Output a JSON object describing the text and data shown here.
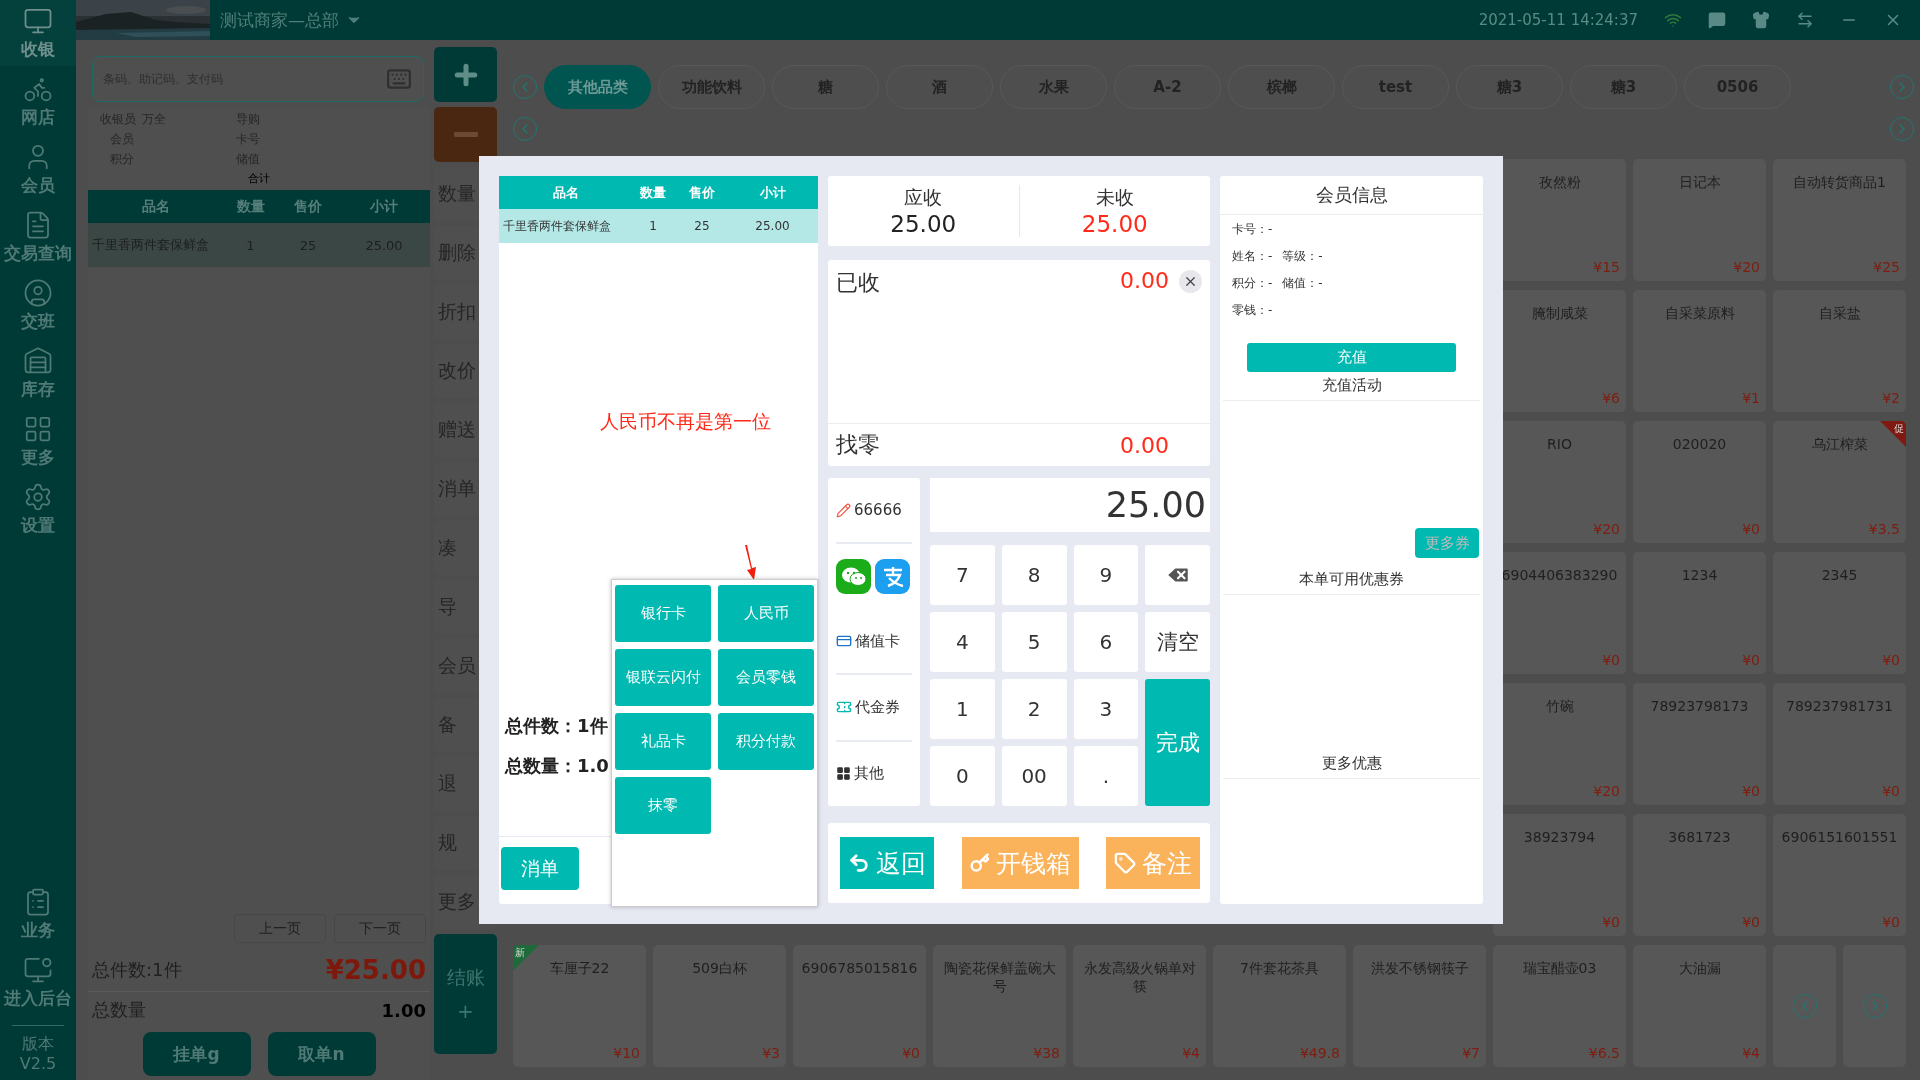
{
  "sidebar": {
    "items": [
      {
        "label": "收银",
        "selected": true
      },
      {
        "label": "网店",
        "selected": false
      },
      {
        "label": "会员",
        "selected": false
      },
      {
        "label": "交易查询",
        "selected": false
      },
      {
        "label": "交班",
        "selected": false
      },
      {
        "label": "库存",
        "selected": false
      },
      {
        "label": "更多",
        "selected": false
      },
      {
        "label": "设置",
        "selected": false
      }
    ],
    "bottom_items": [
      {
        "label": "业务"
      },
      {
        "label": "进入后台"
      }
    ],
    "version_label": "版本",
    "version": "V2.5"
  },
  "top_bar": {
    "store": "测试商家—总部",
    "datetime": "2021-05-11 14:24:37"
  },
  "search": {
    "placeholder": "条码、助记码、支付码"
  },
  "order_info": {
    "cashier_label": "收银员",
    "cashier": "万全",
    "guide_label": "导购",
    "member_label": "会员",
    "card_label": "卡号",
    "points_label": "积分",
    "balance_label": "储值",
    "total_label": "合计"
  },
  "cart": {
    "columns": [
      "品名",
      "数量",
      "售价",
      "小计"
    ],
    "rows": [
      {
        "cells": [
          "千里香两件套保鲜盒",
          "1",
          "25",
          "25.00"
        ],
        "selected": true
      }
    ]
  },
  "pager": {
    "prev": "上一页",
    "next": "下一页"
  },
  "totals": {
    "items": "总件数:1件",
    "amount": "¥25.00",
    "qty_label": "总数量",
    "qty": "1.00"
  },
  "left_buttons": [
    "挂单g",
    "取单n"
  ],
  "action_buttons": [
    "数量",
    "删除",
    "折扣",
    "改价",
    "赠送",
    "消单",
    "凑",
    "导",
    "会员",
    "备",
    "退",
    "规",
    "更多"
  ],
  "checkout": {
    "label": "结账",
    "sub": "+"
  },
  "categories": [
    {
      "label": "其他品类",
      "selected": true
    },
    {
      "label": "功能饮料",
      "selected": false
    },
    {
      "label": "糖",
      "selected": false
    },
    {
      "label": "酒",
      "selected": false
    },
    {
      "label": "水果",
      "selected": false
    },
    {
      "label": "A-2",
      "selected": false
    },
    {
      "label": "槟榔",
      "selected": false
    },
    {
      "label": "test",
      "selected": false
    },
    {
      "label": "糖3",
      "selected": false
    },
    {
      "label": "糖3",
      "selected": false
    },
    {
      "label": "0506",
      "selected": false
    }
  ],
  "products_right": [
    [
      {
        "name": "孜然粉",
        "price": "¥15"
      },
      {
        "name": "日记本",
        "price": "¥20"
      },
      {
        "name": "自动转货商品1",
        "price": "¥25"
      }
    ],
    [
      {
        "name": "腌制咸菜",
        "price": "¥6"
      },
      {
        "name": "自采菜原料",
        "price": "¥1"
      },
      {
        "name": "自采盐",
        "price": "¥2"
      }
    ],
    [
      {
        "name": "RIO",
        "price": "¥20"
      },
      {
        "name": "020020",
        "price": "¥0"
      },
      {
        "name": "乌江榨菜",
        "price": "¥3.5",
        "badge": {
          "kind": "promo",
          "label": "促"
        }
      }
    ],
    [
      {
        "name": "6904406383290",
        "price": "¥0"
      },
      {
        "name": "1234",
        "price": "¥0"
      },
      {
        "name": "2345",
        "price": "¥0"
      }
    ],
    [
      {
        "name": "竹碗",
        "price": "¥20"
      },
      {
        "name": "78923798173",
        "price": "¥0"
      },
      {
        "name": "789237981731",
        "price": "¥0"
      }
    ],
    [
      {
        "name": "38923794",
        "price": "¥0"
      },
      {
        "name": "3681723",
        "price": "¥0"
      },
      {
        "name": "6906151601551",
        "price": "¥0"
      }
    ]
  ],
  "products_bottom": [
    {
      "name": "车厘子22",
      "price": "¥10",
      "badge": {
        "kind": "new",
        "label": "新"
      }
    },
    {
      "name": "509白杯",
      "price": "¥3"
    },
    {
      "name": "6906785015816",
      "price": "¥0"
    },
    {
      "name": "陶瓷花保鲜盖碗大号",
      "price": "¥38"
    },
    {
      "name": "永发高级火锅单对筷",
      "price": "¥4"
    },
    {
      "name": "7件套花茶具",
      "price": "¥49.8"
    },
    {
      "name": "洪发不锈钢筷子",
      "price": "¥7"
    },
    {
      "name": "瑞宝醋壶03",
      "price": "¥6.5"
    },
    {
      "name": "大油漏",
      "price": "¥4"
    }
  ],
  "payment": {
    "order": {
      "columns": [
        "品名",
        "数量",
        "售价",
        "小计"
      ],
      "rows": [
        {
          "cells": [
            "千里香两件套保鲜盒",
            "1",
            "25",
            "25.00"
          ],
          "selected": true
        }
      ],
      "total_items": "总件数：1件",
      "total_qty": "总数量：1.0",
      "buttons": [
        "消单"
      ]
    },
    "due": {
      "label": "应收",
      "value": "25.00"
    },
    "unpaid": {
      "label": "未收",
      "value": "25.00"
    },
    "received": {
      "label": "已收",
      "value": "0.00"
    },
    "change": {
      "label": "找零",
      "value": "0.00"
    },
    "methods": [
      {
        "kind": "edit",
        "label": "66666"
      },
      {
        "kind": "wallets"
      },
      {
        "kind": "stored",
        "label": "储值卡"
      },
      {
        "kind": "voucher",
        "label": "代金券"
      },
      {
        "kind": "other",
        "label": "其他"
      }
    ],
    "amount": "25.00",
    "keys": [
      {
        "kind": "digit",
        "label": "7"
      },
      {
        "kind": "digit",
        "label": "8"
      },
      {
        "kind": "digit",
        "label": "9"
      },
      {
        "kind": "backspace"
      },
      {
        "kind": "digit",
        "label": "4"
      },
      {
        "kind": "digit",
        "label": "5"
      },
      {
        "kind": "digit",
        "label": "6"
      },
      {
        "kind": "clear",
        "label": "清空"
      },
      {
        "kind": "digit",
        "label": "1"
      },
      {
        "kind": "digit",
        "label": "2"
      },
      {
        "kind": "digit",
        "label": "3"
      },
      {
        "kind": "done",
        "label": "完成"
      },
      {
        "kind": "digit",
        "label": "0"
      },
      {
        "kind": "digit",
        "label": "00"
      },
      {
        "kind": "digit",
        "label": "."
      }
    ],
    "bottom_actions": [
      {
        "kind": "back",
        "label": "返回"
      },
      {
        "kind": "drawer",
        "label": "开钱箱"
      },
      {
        "kind": "note",
        "label": "备注"
      }
    ],
    "member": {
      "title": "会员信息",
      "lines": [
        [
          "卡号：-"
        ],
        [
          "姓名：-",
          "等级：-"
        ],
        [
          "积分：-",
          "储值：-"
        ],
        [
          "零钱：-"
        ]
      ],
      "recharge": "充值",
      "recharge_activity": "充值活动",
      "more_coupons": "更多券",
      "coupons_title": "本单可用优惠券",
      "more_offers": "更多优惠"
    },
    "popover": {
      "options": [
        "银行卡",
        "人民币",
        "银联云闪付",
        "会员零钱",
        "礼品卡",
        "积分付款",
        "抹零"
      ]
    },
    "annotation": "人民币不再是第一位"
  }
}
